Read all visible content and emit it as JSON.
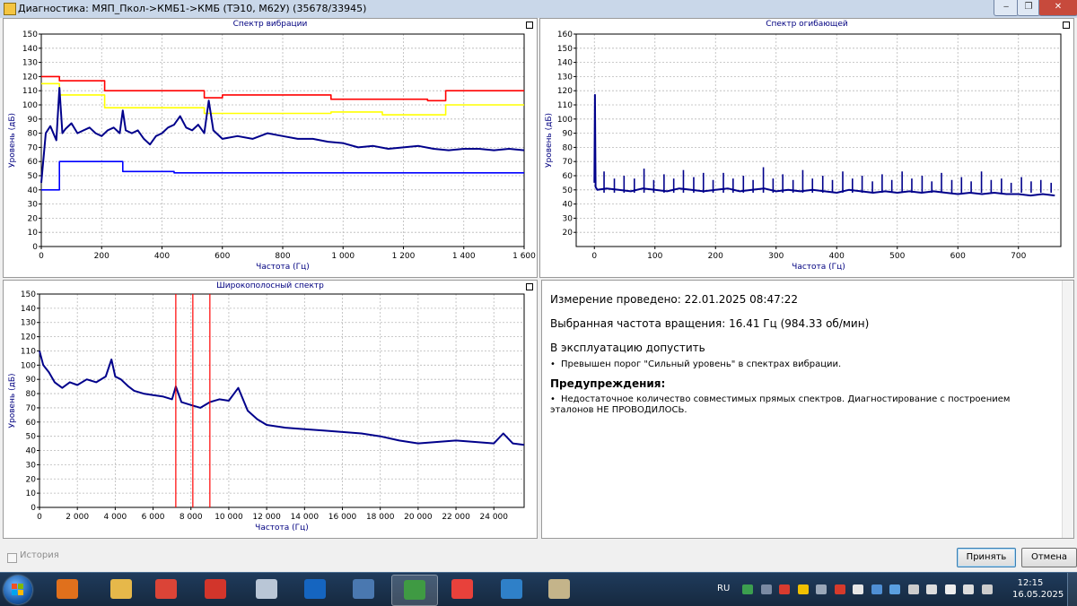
{
  "window": {
    "title": "Диагностика: МЯП_Пкол->КМБ1->КМБ (ТЭ10, М62У) (35678/33945)",
    "minimize_glyph": "‒",
    "restore_glyph": "❐",
    "close_glyph": "✕"
  },
  "charts": {
    "vibration": {
      "title": "Спектр вибрации"
    },
    "envelope": {
      "title": "Спектр огибающей"
    },
    "broadband": {
      "title": "Широкополосный спектр"
    }
  },
  "chart_data": [
    {
      "type": "line",
      "title": "Спектр вибрации",
      "xlabel": "Частота (Гц)",
      "ylabel": "Уровень (дБ)",
      "xlim": [
        0,
        1600
      ],
      "ylim": [
        0,
        150
      ],
      "xticks": [
        0,
        200,
        400,
        600,
        800,
        1000,
        1200,
        1400,
        1600
      ],
      "xtick_labels": [
        "0",
        "200",
        "400",
        "600",
        "800",
        "1 000",
        "1 200",
        "1 400",
        "1 600"
      ],
      "yticks": [
        0,
        10,
        20,
        30,
        40,
        50,
        60,
        70,
        80,
        90,
        100,
        110,
        120,
        130,
        140,
        150
      ],
      "grid": true,
      "series": [
        {
          "color": "#ff0000",
          "style": "step",
          "x": [
            0,
            60,
            60,
            210,
            210,
            540,
            540,
            600,
            600,
            960,
            960,
            1280,
            1280,
            1340,
            1340,
            1600
          ],
          "y": [
            120,
            120,
            117,
            117,
            110,
            110,
            105,
            105,
            107,
            107,
            104,
            104,
            103,
            103,
            110,
            110
          ]
        },
        {
          "color": "#ffff00",
          "style": "step",
          "x": [
            0,
            60,
            60,
            210,
            210,
            540,
            540,
            960,
            960,
            1130,
            1130,
            1340,
            1340,
            1600
          ],
          "y": [
            115,
            115,
            107,
            107,
            98,
            98,
            94,
            94,
            95,
            95,
            93,
            93,
            100,
            100
          ]
        },
        {
          "color": "#0000ff",
          "style": "step",
          "x": [
            0,
            60,
            60,
            270,
            270,
            440,
            440,
            1600
          ],
          "y": [
            40,
            40,
            60,
            60,
            53,
            53,
            52,
            52
          ]
        },
        {
          "color": "#00008b",
          "style": "line",
          "x": [
            0,
            15,
            30,
            50,
            60,
            70,
            80,
            100,
            120,
            140,
            160,
            180,
            200,
            220,
            240,
            260,
            270,
            280,
            300,
            320,
            340,
            360,
            380,
            400,
            420,
            440,
            460,
            480,
            500,
            520,
            540,
            555,
            570,
            600,
            650,
            700,
            750,
            800,
            850,
            900,
            950,
            1000,
            1050,
            1100,
            1150,
            1200,
            1250,
            1300,
            1350,
            1400,
            1450,
            1500,
            1550,
            1600
          ],
          "y": [
            45,
            80,
            85,
            75,
            112,
            80,
            83,
            87,
            80,
            82,
            84,
            80,
            78,
            82,
            84,
            80,
            96,
            82,
            80,
            82,
            76,
            72,
            78,
            80,
            84,
            86,
            92,
            84,
            82,
            86,
            80,
            103,
            82,
            76,
            78,
            76,
            80,
            78,
            76,
            76,
            74,
            73,
            70,
            71,
            69,
            70,
            71,
            69,
            68,
            69,
            69,
            68,
            69,
            68
          ]
        }
      ]
    },
    {
      "type": "line",
      "title": "Спектр огибающей",
      "xlabel": "Частота (Гц)",
      "ylabel": "Уровень (дБ)",
      "xlim": [
        -30,
        770
      ],
      "ylim": [
        10,
        160
      ],
      "xticks": [
        0,
        100,
        200,
        300,
        400,
        500,
        600,
        700
      ],
      "yticks": [
        20,
        30,
        40,
        50,
        60,
        70,
        80,
        90,
        100,
        110,
        120,
        130,
        140,
        150,
        160
      ],
      "grid": true,
      "series": [
        {
          "color": "#00008b",
          "style": "line",
          "x": [
            0,
            1,
            2,
            5,
            20,
            40,
            60,
            80,
            100,
            120,
            140,
            160,
            180,
            200,
            220,
            240,
            260,
            280,
            300,
            320,
            340,
            360,
            380,
            400,
            420,
            440,
            460,
            480,
            500,
            520,
            540,
            560,
            580,
            600,
            620,
            640,
            660,
            680,
            700,
            720,
            740,
            760
          ],
          "y": [
            55,
            117,
            52,
            50,
            51,
            50,
            49,
            51,
            50,
            49,
            51,
            50,
            49,
            50,
            51,
            49,
            50,
            51,
            49,
            50,
            49,
            50,
            49,
            48,
            50,
            49,
            48,
            49,
            48,
            49,
            48,
            49,
            48,
            47,
            48,
            47,
            48,
            47,
            47,
            46,
            47,
            46
          ]
        },
        {
          "color": "#00008b",
          "style": "peaks",
          "x": [
            16,
            33,
            49,
            66,
            82,
            98,
            115,
            131,
            147,
            164,
            180,
            196,
            213,
            229,
            246,
            262,
            279,
            295,
            311,
            328,
            344,
            360,
            377,
            393,
            410,
            426,
            442,
            459,
            475,
            491,
            508,
            524,
            541,
            557,
            573,
            590,
            606,
            622,
            639,
            655,
            672,
            688,
            705,
            721,
            737,
            754
          ],
          "y": [
            63,
            58,
            60,
            58,
            65,
            57,
            61,
            58,
            64,
            59,
            62,
            57,
            62,
            58,
            60,
            57,
            66,
            58,
            61,
            57,
            64,
            58,
            60,
            57,
            63,
            58,
            60,
            56,
            61,
            57,
            63,
            58,
            60,
            56,
            62,
            57,
            59,
            56,
            63,
            57,
            58,
            55,
            59,
            56,
            57,
            55
          ]
        }
      ]
    },
    {
      "type": "line",
      "title": "Широкополосный спектр",
      "xlabel": "Частота (Гц)",
      "ylabel": "Уровень (дБ)",
      "xlim": [
        0,
        25600
      ],
      "ylim": [
        0,
        150
      ],
      "xticks": [
        0,
        2000,
        4000,
        6000,
        8000,
        10000,
        12000,
        14000,
        16000,
        18000,
        20000,
        22000,
        24000
      ],
      "xtick_labels": [
        "0",
        "2 000",
        "4 000",
        "6 000",
        "8 000",
        "10 000",
        "12 000",
        "14 000",
        "16 000",
        "18 000",
        "20 000",
        "22 000",
        "24 000"
      ],
      "yticks": [
        0,
        10,
        20,
        30,
        40,
        50,
        60,
        70,
        80,
        90,
        100,
        110,
        120,
        130,
        140,
        150
      ],
      "grid": true,
      "markers": [
        {
          "x": 7200,
          "color": "#ff0000"
        },
        {
          "x": 8100,
          "color": "#ff0000"
        },
        {
          "x": 9000,
          "color": "#ff0000"
        }
      ],
      "series": [
        {
          "color": "#00008b",
          "style": "line",
          "x": [
            0,
            200,
            500,
            800,
            1200,
            1600,
            2000,
            2500,
            3000,
            3500,
            3800,
            4000,
            4300,
            4700,
            5000,
            5500,
            6000,
            6500,
            7000,
            7200,
            7500,
            8000,
            8500,
            9000,
            9500,
            10000,
            10500,
            11000,
            11500,
            12000,
            13000,
            14000,
            15000,
            16000,
            17000,
            18000,
            19000,
            20000,
            21000,
            22000,
            23000,
            24000,
            24500,
            25000,
            25600
          ],
          "y": [
            110,
            100,
            95,
            88,
            84,
            88,
            86,
            90,
            88,
            92,
            104,
            92,
            90,
            85,
            82,
            80,
            79,
            78,
            76,
            85,
            74,
            72,
            70,
            74,
            76,
            75,
            84,
            68,
            62,
            58,
            56,
            55,
            54,
            53,
            52,
            50,
            47,
            45,
            46,
            47,
            46,
            45,
            52,
            45,
            44
          ]
        }
      ]
    }
  ],
  "info": {
    "measured": "Измерение проведено: 22.01.2025 08:47:22",
    "speed": "Выбранная частота вращения: 16.41 Гц  (984.33 об/мин)",
    "verdict": "В эксплуатацию допустить",
    "bullet_dot": "•",
    "bullet1": "Превышен порог \"Сильный уровень\" в спектрах вибрации.",
    "warnings_title": "Предупреждения:",
    "bullet2": "Недостаточное количество совместимых прямых спектров. Диагностирование с построением эталонов НЕ ПРОВОДИЛОСЬ."
  },
  "bottom": {
    "history_label": "История",
    "accept_label": "Принять",
    "cancel_label": "Отмена"
  },
  "taskbar": {
    "lang": "RU",
    "time": "12:15",
    "date": "16.05.2025",
    "apps": [
      {
        "name": "media-player-icon",
        "color": "#e0701c"
      },
      {
        "name": "file-explorer-icon",
        "color": "#e6b84a"
      },
      {
        "name": "chrome-icon",
        "color": "#db4437"
      },
      {
        "name": "ccleaner-icon",
        "color": "#d2352b"
      },
      {
        "name": "database-icon",
        "color": "#b9c6d6"
      },
      {
        "name": "outlook-icon",
        "color": "#1565c0"
      },
      {
        "name": "calculator-icon",
        "color": "#4a78b0"
      },
      {
        "name": "diagnostics-app-icon",
        "color": "#3f9a43"
      },
      {
        "name": "anydesk-icon",
        "color": "#e8413b"
      },
      {
        "name": "scanner-icon",
        "color": "#2f80c8"
      },
      {
        "name": "tools-icon",
        "color": "#c4b48a"
      }
    ],
    "tray": [
      {
        "name": "tray-app-icon",
        "color": "#3c9f4f"
      },
      {
        "name": "tray-network-icon",
        "color": "#7a8aa3"
      },
      {
        "name": "tray-anydesk-icon",
        "color": "#d83b2f"
      },
      {
        "name": "tray-warning-icon",
        "color": "#f0c000"
      },
      {
        "name": "tray-eye-icon",
        "color": "#9aa7b8"
      },
      {
        "name": "tray-red-app-icon",
        "color": "#d63a2b"
      },
      {
        "name": "tray-v-icon",
        "color": "#e6e6e6"
      },
      {
        "name": "tray-ok-icon",
        "color": "#4f8fd4"
      },
      {
        "name": "tray-chat-icon",
        "color": "#5a9fe0"
      },
      {
        "name": "tray-battery-icon",
        "color": "#cccccc"
      },
      {
        "name": "tray-volume-icon",
        "color": "#dddddd"
      },
      {
        "name": "tray-flag-icon",
        "color": "#eeeeee"
      },
      {
        "name": "tray-signal-icon",
        "color": "#dddddd"
      },
      {
        "name": "tray-monitor-icon",
        "color": "#cccccc"
      }
    ]
  }
}
